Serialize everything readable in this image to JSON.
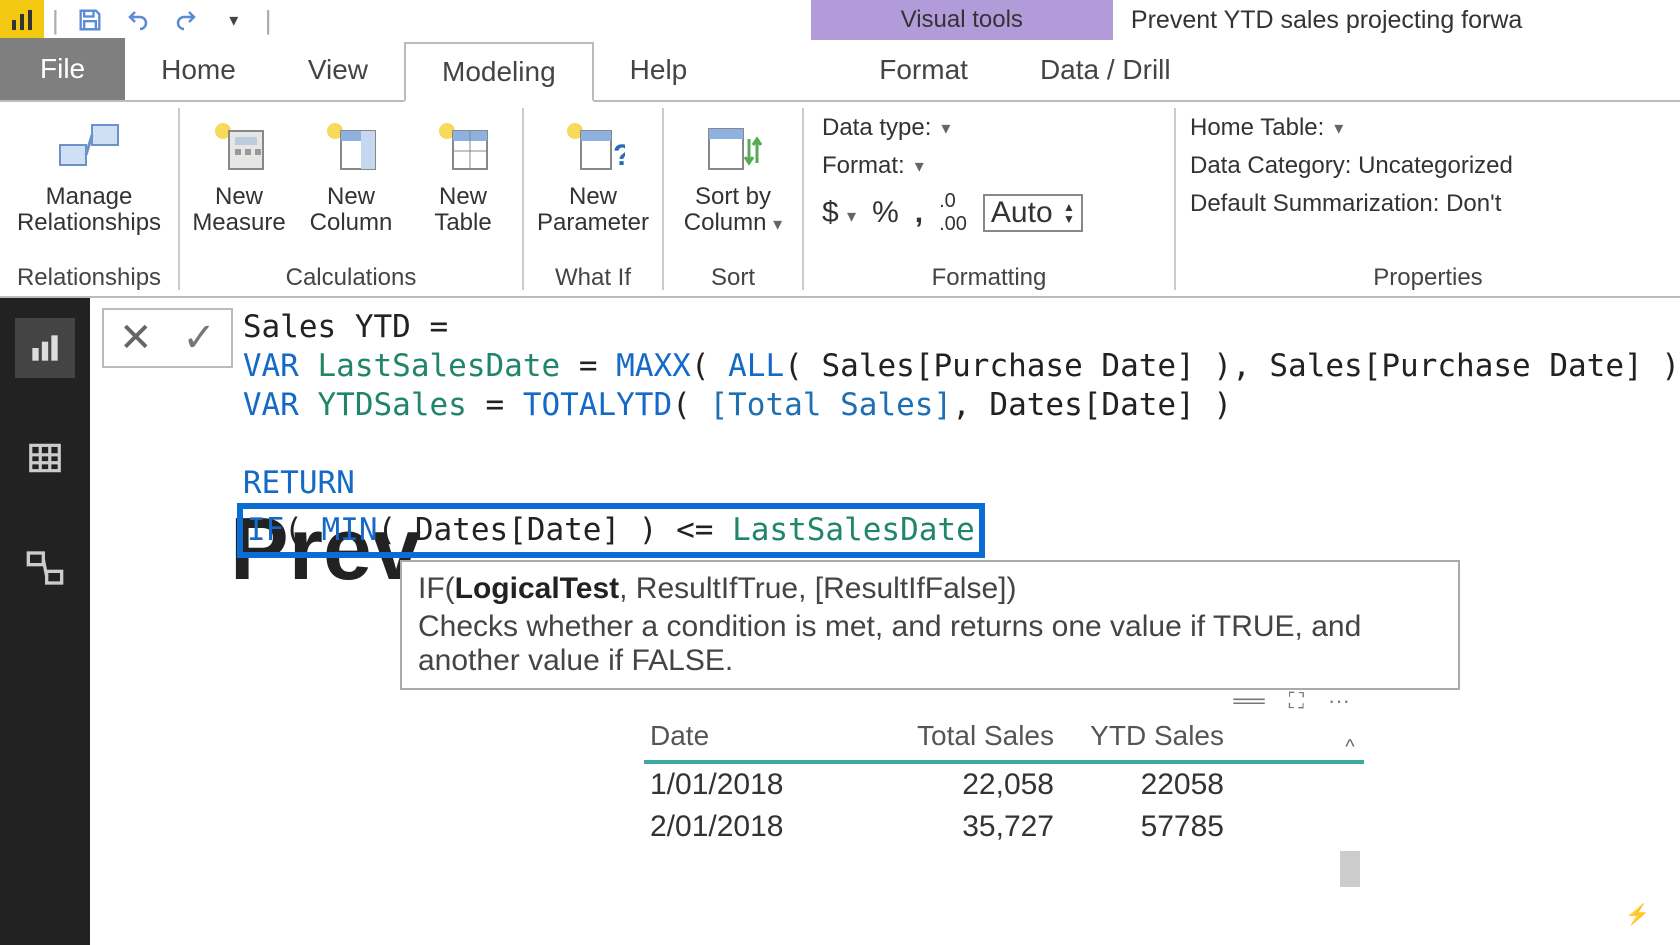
{
  "titlebar": {
    "contextual_tab": "Visual tools",
    "doc_title": "Prevent YTD sales projecting forwa"
  },
  "tabs": {
    "file": "File",
    "home": "Home",
    "view": "View",
    "modeling": "Modeling",
    "help": "Help",
    "format": "Format",
    "data_drill": "Data / Drill"
  },
  "ribbon": {
    "relationships": {
      "manage": "Manage\nRelationships",
      "group": "Relationships"
    },
    "calculations": {
      "measure": "New\nMeasure",
      "column": "New\nColumn",
      "table": "New\nTable",
      "group": "Calculations"
    },
    "whatif": {
      "param": "New\nParameter",
      "group": "What If"
    },
    "sort": {
      "sortby": "Sort by\nColumn",
      "group": "Sort"
    },
    "formatting": {
      "data_type": "Data type:",
      "format": "Format:",
      "dollar": "$",
      "percent": "%",
      "comma": ",",
      "dec": ".00",
      "auto": "Auto",
      "group": "Formatting"
    },
    "properties": {
      "home_table": "Home Table:",
      "data_category": "Data Category: Uncategorized",
      "default_sum": "Default Summarization: Don't",
      "group": "Properties"
    }
  },
  "formula": {
    "line1": "Sales YTD =",
    "var_kw": "VAR",
    "lsd_name": "LastSalesDate",
    "maxx": "MAXX",
    "all": "ALL",
    "lsd_rest_a": "( Sales[Purchase Date] ), Sales[Purchase Date] )",
    "ytd_name": "YTDSales",
    "totalytd": "TOTALYTD",
    "total_sales": "[Total Sales]",
    "ytd_rest": ", Dates[Date] )",
    "return": "RETURN",
    "if": "IF",
    "min": "MIN",
    "if_mid": "( Dates[Date] ) <= ",
    "lsd_ref": "LastSalesDate"
  },
  "tooltip": {
    "sig_prefix": "IF(",
    "sig_logical": "LogicalTest",
    "sig_rest": ", ResultIfTrue, [ResultIfFalse])",
    "desc": "Checks whether a condition is met, and returns one value if TRUE, and another value if FALSE."
  },
  "page": {
    "title": "Prev"
  },
  "table": {
    "headers": {
      "date": "Date",
      "total": "Total Sales",
      "ytd": "YTD Sales"
    },
    "rows": [
      {
        "date": "1/01/2018",
        "total": "22,058",
        "ytd": "22058"
      },
      {
        "date": "2/01/2018",
        "total": "35,727",
        "ytd": "57785"
      }
    ]
  }
}
